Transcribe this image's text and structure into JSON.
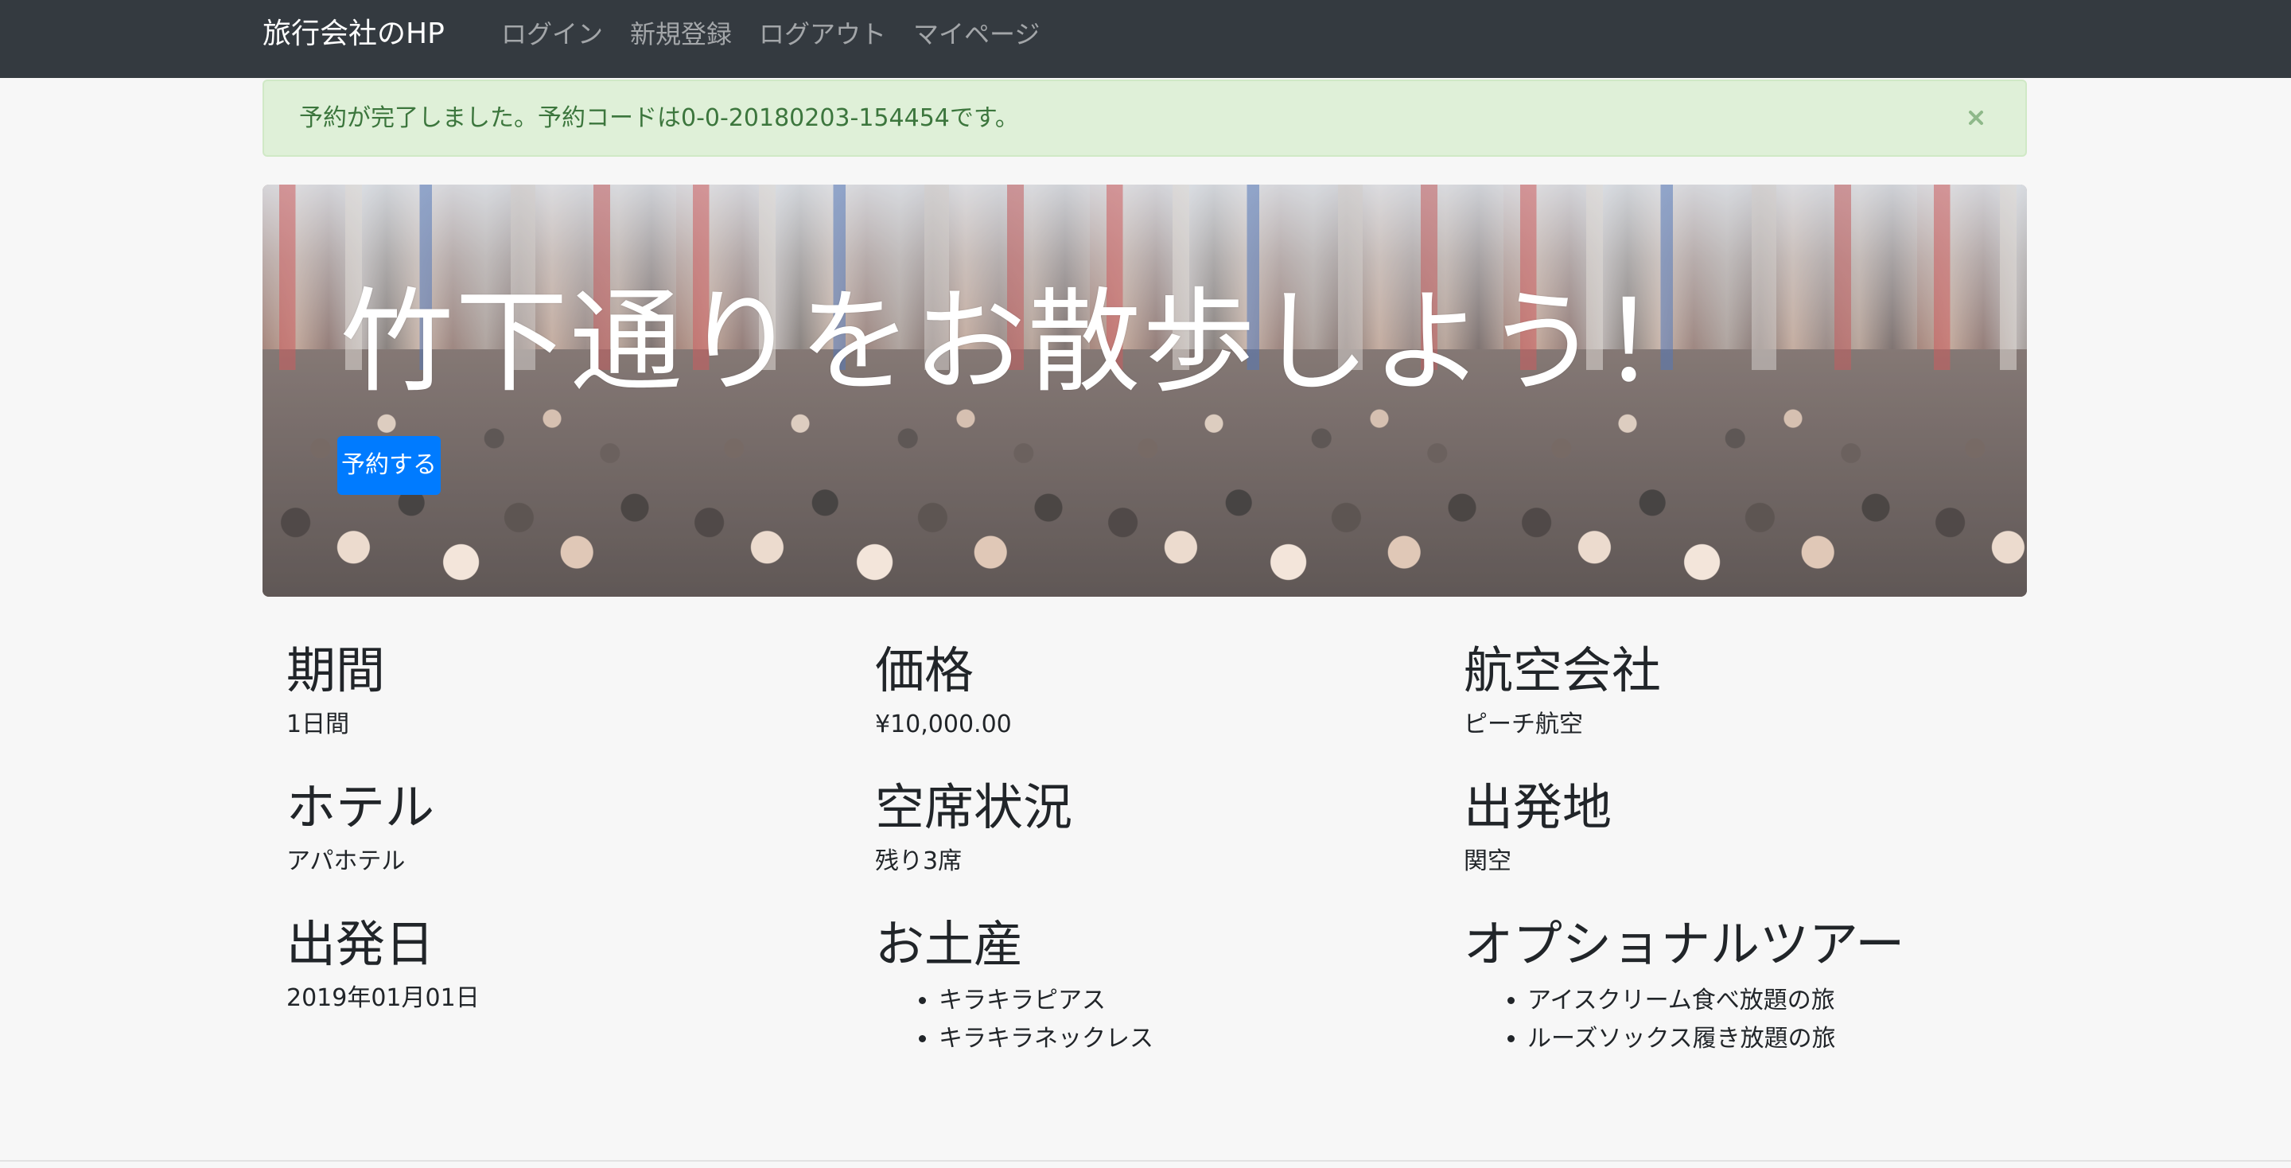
{
  "navbar": {
    "brand": "旅行会社のHP",
    "links": [
      "ログイン",
      "新規登録",
      "ログアウト",
      "マイページ"
    ]
  },
  "alert": {
    "message": "予約が完了しました。予約コードは0-0-20180203-154454です。",
    "close_icon": "close-icon"
  },
  "hero": {
    "title": "竹下通りをお散歩しよう！",
    "button_label": "予約する"
  },
  "details": {
    "period": {
      "heading": "期間",
      "value": "1日間"
    },
    "price": {
      "heading": "価格",
      "value": "¥10,000.00"
    },
    "airline": {
      "heading": "航空会社",
      "value": "ピーチ航空"
    },
    "hotel": {
      "heading": "ホテル",
      "value": "アパホテル"
    },
    "seats": {
      "heading": "空席状況",
      "value": "残り3席"
    },
    "departure_place": {
      "heading": "出発地",
      "value": "関空"
    },
    "departure_date": {
      "heading": "出発日",
      "value": "2019年01月01日"
    },
    "souvenirs": {
      "heading": "お土産",
      "items": [
        "キラキラピアス",
        "キラキラネックレス"
      ]
    },
    "optional_tours": {
      "heading": "オプショナルツアー",
      "items": [
        "アイスクリーム食べ放題の旅",
        "ルーズソックス履き放題の旅"
      ]
    }
  },
  "colors": {
    "navbar_bg": "#343a40",
    "alert_bg": "#dff0d8",
    "alert_text": "#3c763d",
    "primary": "#007bff",
    "page_bg": "#f7f7f7"
  }
}
